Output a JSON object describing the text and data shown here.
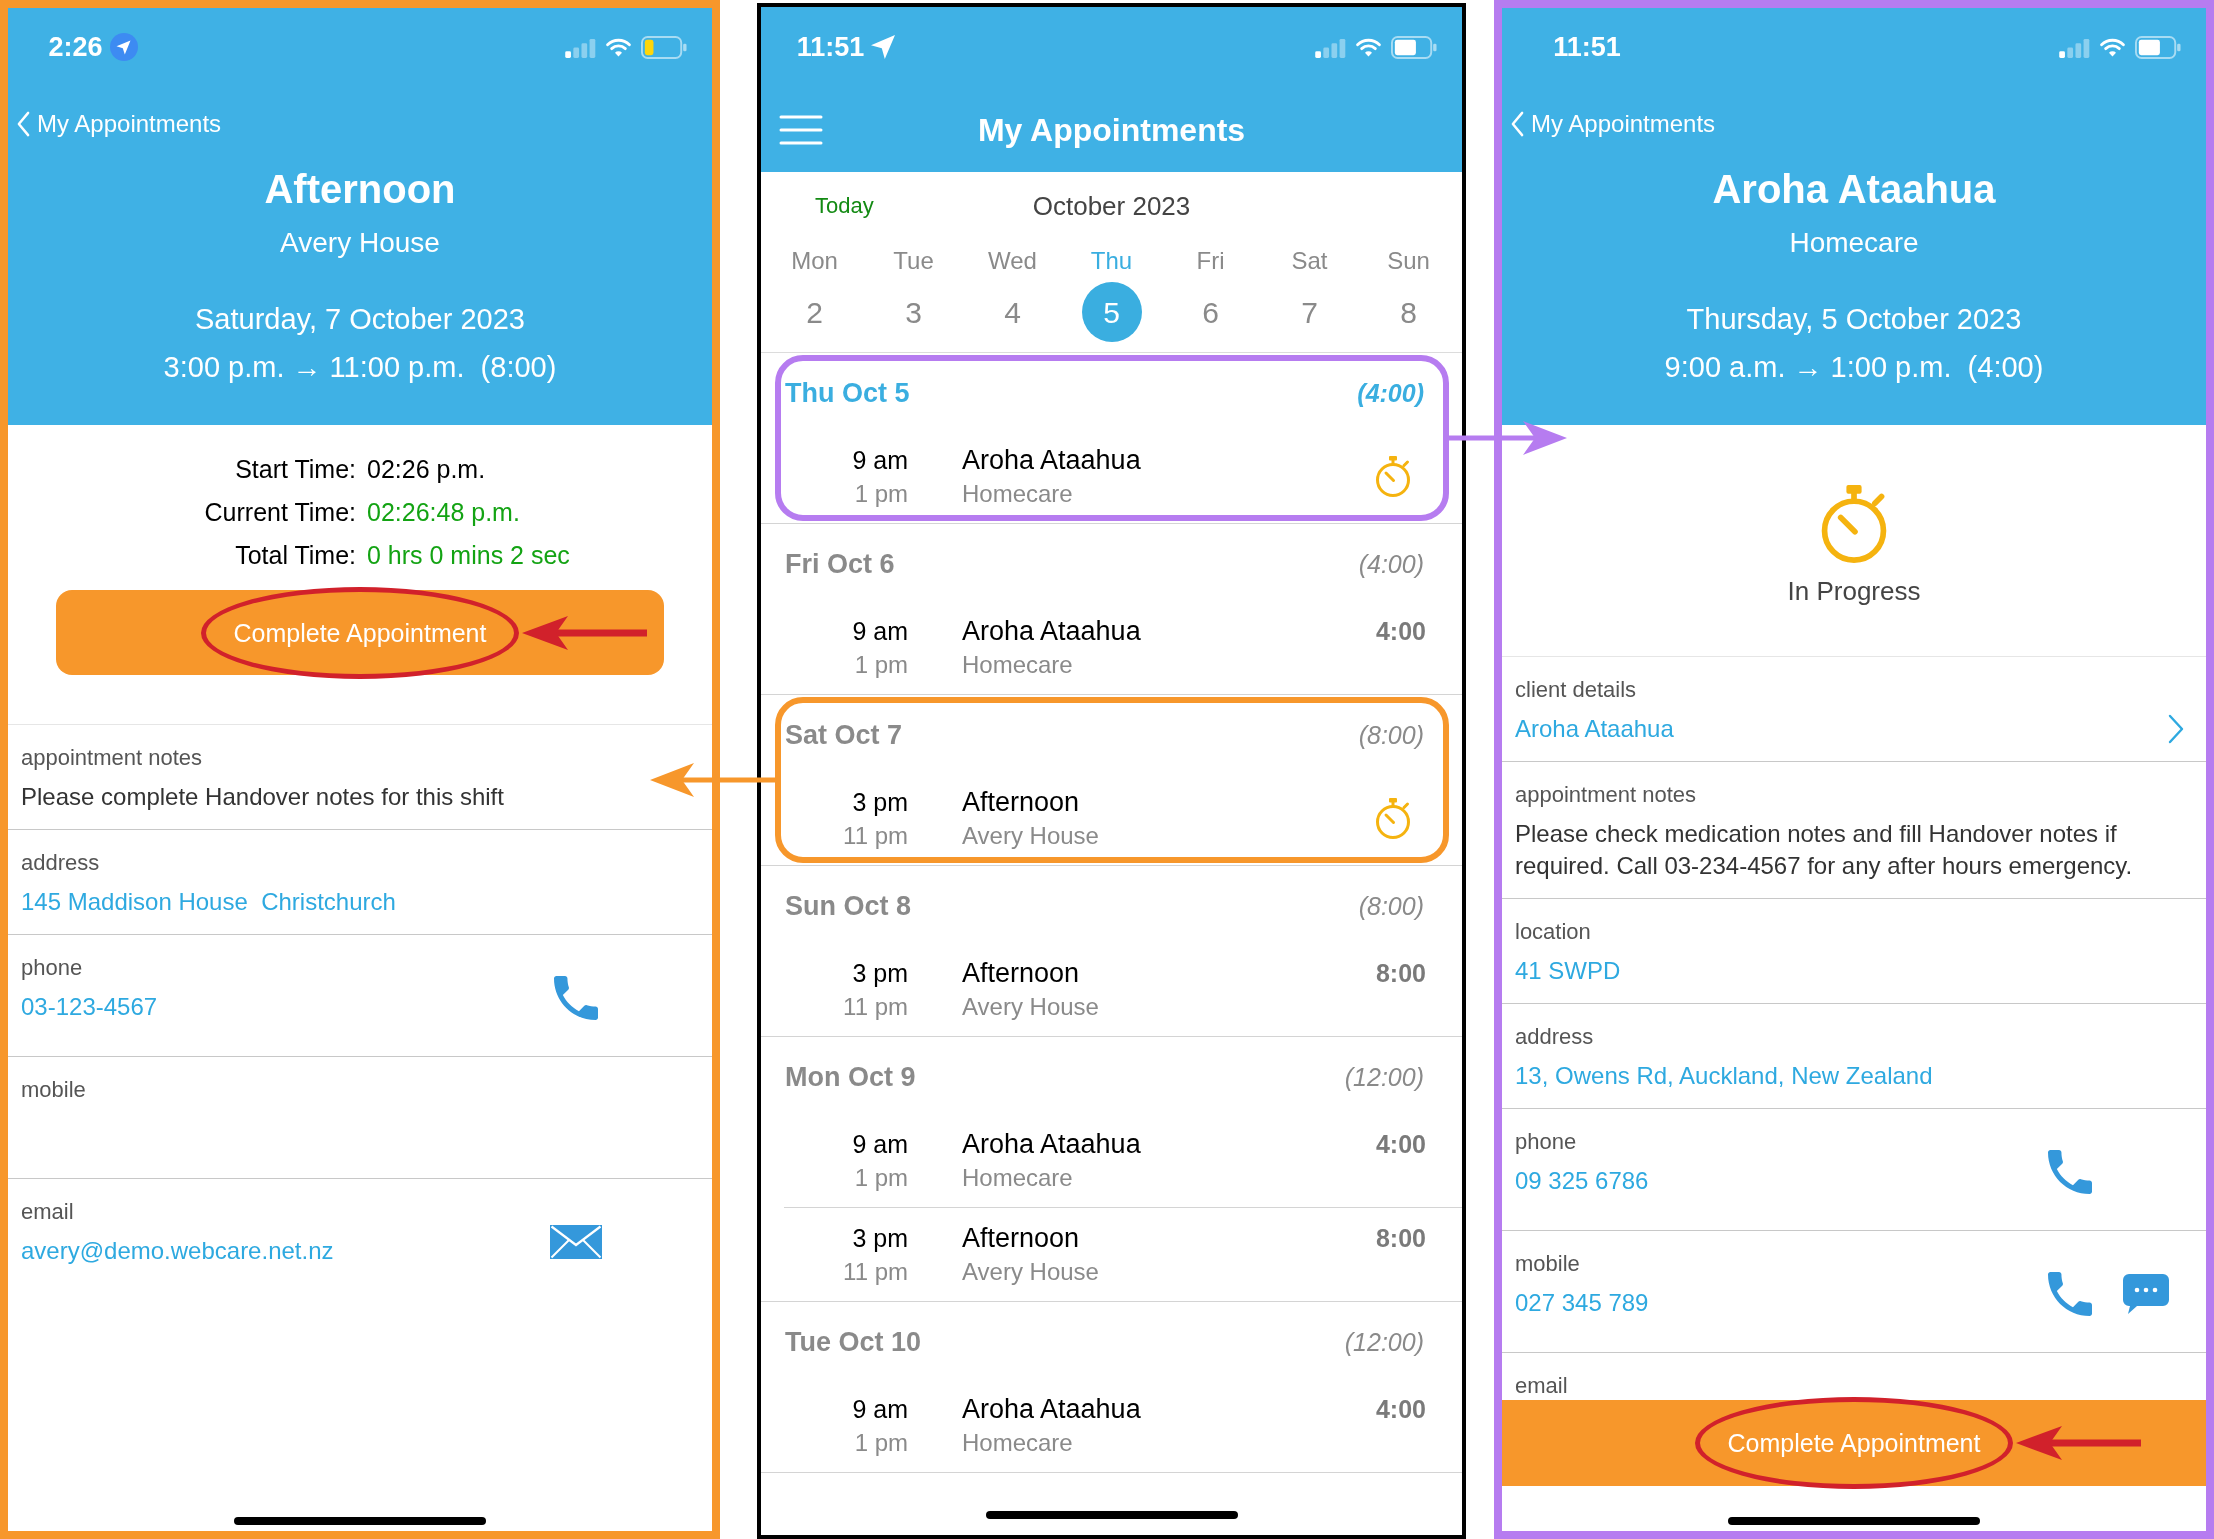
{
  "screens": [
    {
      "kind": "detail",
      "color": "#f7972b",
      "status_bar": {
        "time": "2:26",
        "location": true,
        "location_badge": true,
        "low_power": true
      },
      "back_label": "My Appointments",
      "title": "Afternoon",
      "subtitle": "Avery House",
      "date": "Saturday, 7 October 2023",
      "time_range": "3:00 p.m. → 11:00 p.m.  (8:00)",
      "timer": [
        {
          "label": "Start Time:",
          "value": "02:26 p.m.",
          "live": false
        },
        {
          "label": "Current Time:",
          "value": "02:26:48 p.m.",
          "live": true
        },
        {
          "label": "Total Time:",
          "value": "0 hrs 0 mins 2 sec",
          "live": true
        }
      ],
      "complete_button": {
        "label": "Complete Appointment",
        "circled": true
      },
      "fields": [
        {
          "kind": "note",
          "label": "appointment notes",
          "value": "Please complete Handover notes for this shift"
        },
        {
          "kind": "link",
          "label": "address",
          "value": "145 Maddison House  Christchurch"
        },
        {
          "kind": "contact",
          "label": "phone",
          "value": "03-123-4567",
          "actions": [
            {
              "kind": "call"
            }
          ]
        },
        {
          "kind": "contact",
          "label": "mobile"
        },
        {
          "kind": "contact",
          "label": "email",
          "value": "avery@demo.webcare.net.nz",
          "actions": [
            {
              "kind": "email"
            }
          ]
        }
      ]
    },
    {
      "kind": "list",
      "color": "#000000",
      "status_bar": {
        "time": "11:51",
        "location": true,
        "location_badge": false,
        "low_power": false
      },
      "title": "My Appointments",
      "today_label": "Today",
      "month": "October 2023",
      "week": [
        {
          "day": "Mon",
          "date": "2",
          "selected": false
        },
        {
          "day": "Tue",
          "date": "3",
          "selected": false
        },
        {
          "day": "Wed",
          "date": "4",
          "selected": false
        },
        {
          "day": "Thu",
          "date": "5",
          "selected": true
        },
        {
          "day": "Fri",
          "date": "6",
          "selected": false
        },
        {
          "day": "Sat",
          "date": "7",
          "selected": false
        },
        {
          "day": "Sun",
          "date": "8",
          "selected": false
        }
      ],
      "days": [
        {
          "label": "Thu Oct 5",
          "total": "(4:00)",
          "today": true,
          "annotations": [
            {
              "kind": "outline",
              "color": "#b67cf0"
            },
            {
              "kind": "arrow_right",
              "color": "#b67cf0"
            }
          ],
          "appointments": [
            {
              "start": "9 am",
              "end": "1 pm",
              "client": "Aroha Ataahua",
              "place": "Homecare",
              "in_progress": true
            }
          ]
        },
        {
          "label": "Fri Oct 6",
          "total": "(4:00)",
          "today": false,
          "appointments": [
            {
              "start": "9 am",
              "end": "1 pm",
              "client": "Aroha Ataahua",
              "place": "Homecare",
              "in_progress": false,
              "duration": "4:00"
            }
          ]
        },
        {
          "label": "Sat Oct 7",
          "total": "(8:00)",
          "today": false,
          "annotations": [
            {
              "kind": "outline",
              "color": "#f7972b"
            },
            {
              "kind": "arrow_left",
              "color": "#f7972b"
            }
          ],
          "appointments": [
            {
              "start": "3 pm",
              "end": "11 pm",
              "client": "Afternoon",
              "place": "Avery House",
              "in_progress": true
            }
          ]
        },
        {
          "label": "Sun Oct 8",
          "total": "(8:00)",
          "today": false,
          "appointments": [
            {
              "start": "3 pm",
              "end": "11 pm",
              "client": "Afternoon",
              "place": "Avery House",
              "in_progress": false,
              "duration": "8:00"
            }
          ]
        },
        {
          "label": "Mon Oct 9",
          "total": "(12:00)",
          "today": false,
          "appointments": [
            {
              "start": "9 am",
              "end": "1 pm",
              "client": "Aroha Ataahua",
              "place": "Homecare",
              "in_progress": false,
              "duration": "4:00"
            },
            {
              "start": "3 pm",
              "end": "11 pm",
              "client": "Afternoon",
              "place": "Avery House",
              "in_progress": false,
              "duration": "8:00"
            }
          ]
        },
        {
          "label": "Tue Oct 10",
          "total": "(12:00)",
          "today": false,
          "appointments": [
            {
              "start": "9 am",
              "end": "1 pm",
              "client": "Aroha Ataahua",
              "place": "Homecare",
              "in_progress": false,
              "duration": "4:00"
            }
          ]
        }
      ]
    },
    {
      "kind": "detail",
      "color": "#b67cf0",
      "status_bar": {
        "time": "11:51",
        "low_power": false
      },
      "back_label": "My Appointments",
      "title": "Aroha Ataahua",
      "subtitle": "Homecare",
      "date": "Thursday, 5 October 2023",
      "time_range": "9:00 a.m. → 1:00 p.m.  (4:00)",
      "status": {
        "label": "In Progress"
      },
      "fields": [
        {
          "kind": "link",
          "label": "client details",
          "value": "Aroha Ataahua",
          "actions": [
            {
              "kind": "open"
            }
          ]
        },
        {
          "kind": "note",
          "label": "appointment notes",
          "value": "Please check medication notes and fill Handover notes if required. Call 03-234-4567 for any after hours emergency."
        },
        {
          "kind": "link",
          "label": "location",
          "value": "41 SWPD"
        },
        {
          "kind": "link",
          "label": "address",
          "value": "13, Owens Rd, Auckland, New Zealand"
        },
        {
          "kind": "contact",
          "label": "phone",
          "value": "09 325 6786",
          "actions": [
            {
              "kind": "call"
            }
          ]
        },
        {
          "kind": "contact",
          "label": "mobile",
          "value": "027 345 789",
          "actions": [
            {
              "kind": "call"
            },
            {
              "kind": "message"
            }
          ]
        },
        {
          "kind": "contact",
          "label": "email"
        }
      ],
      "bottom_button": {
        "label": "Complete Appointment",
        "circled": true
      }
    }
  ]
}
